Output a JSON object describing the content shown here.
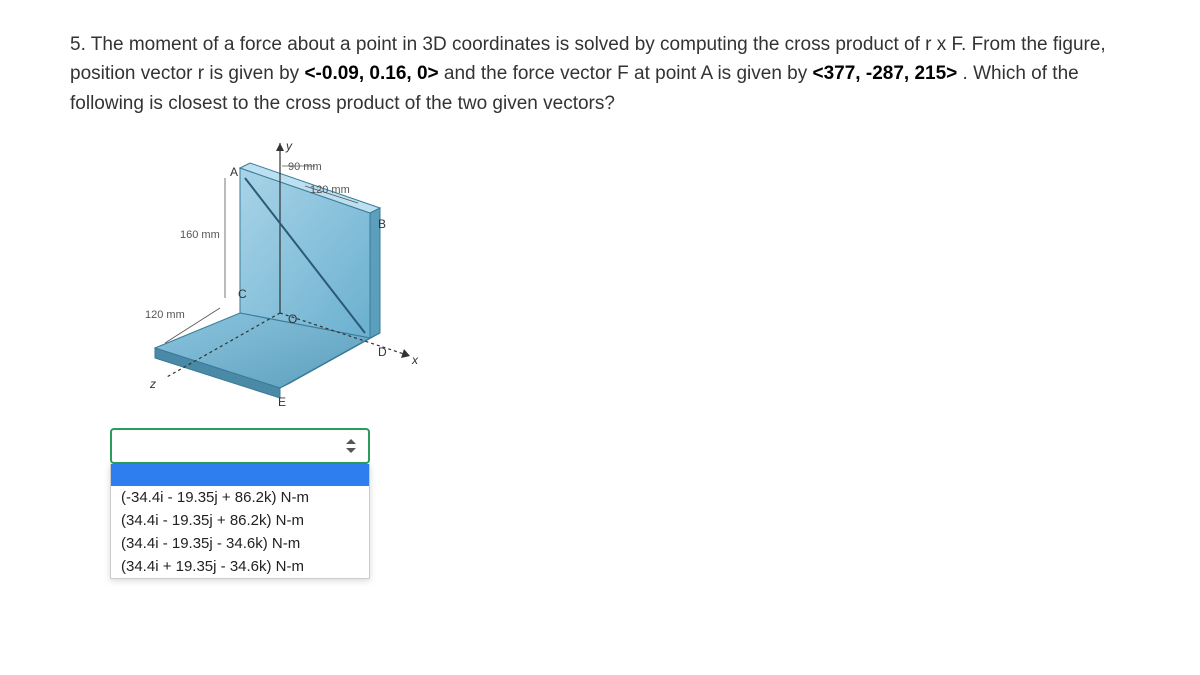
{
  "question": {
    "number": "5.",
    "text_1": "The moment of a force about a point in 3D coordinates is solved by computing the cross product of r x F. From the figure, position vector r is given by ",
    "bold_1": "<-0.09, 0.16, 0>",
    "text_2": " and the force vector F at point A is given by ",
    "bold_2": "<377, -287, 215>",
    "text_3": " . Which of the following is closest to the cross product of the two given vectors?"
  },
  "figure": {
    "labels": {
      "dim90": "90 mm",
      "dim120a": "120 mm",
      "dim160": "160 mm",
      "dim120b": "120 mm",
      "A": "A",
      "B": "B",
      "C": "C",
      "D": "D",
      "E": "E",
      "O": "O",
      "y": "y",
      "x": "x",
      "z": "z"
    }
  },
  "options": [
    "(-34.4i - 19.35j + 86.2k) N-m",
    "(34.4i - 19.35j + 86.2k) N-m",
    "(34.4i - 19.35j - 34.6k) N-m",
    "(34.4i + 19.35j - 34.6k) N-m"
  ]
}
